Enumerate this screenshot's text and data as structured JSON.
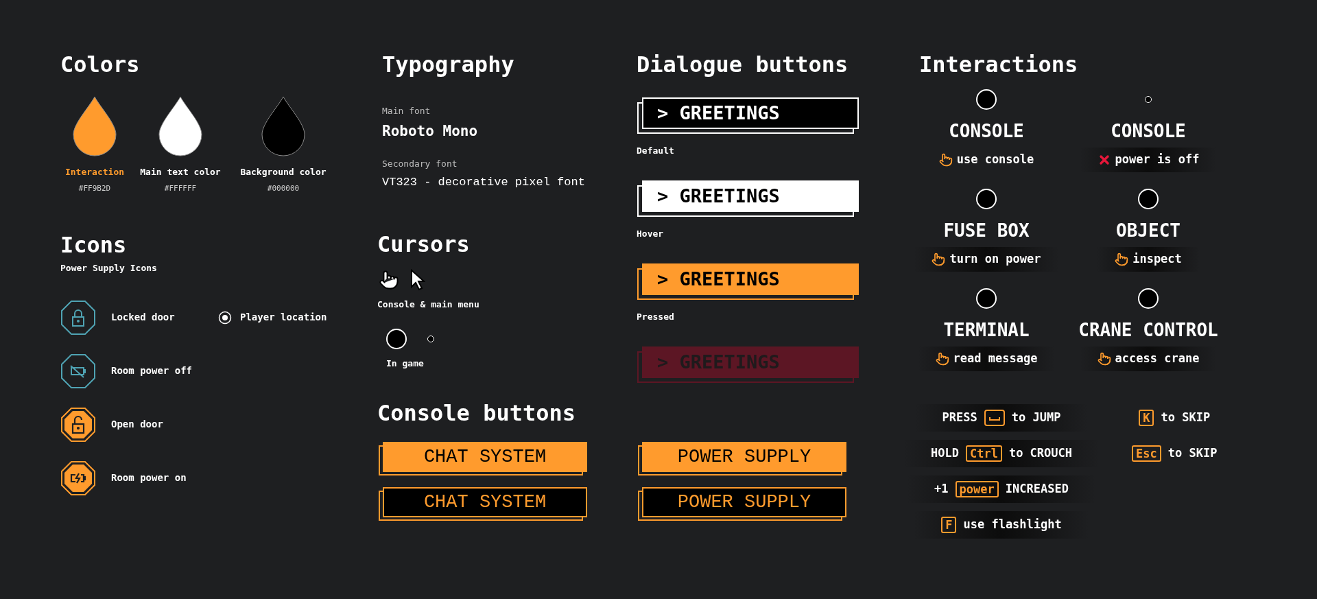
{
  "colors": {
    "title": "Colors",
    "swatches": [
      {
        "name": "Interaction",
        "hex": "#FF9B2D",
        "color": "#ff9b2d",
        "accent": true
      },
      {
        "name": "Main text color",
        "hex": "#FFFFFF",
        "color": "#ffffff",
        "accent": false
      },
      {
        "name": "Background color",
        "hex": "#000000",
        "color": "#000000",
        "accent": false
      }
    ]
  },
  "icons": {
    "title": "Icons",
    "subtitle": "Power Supply Icons",
    "items": [
      {
        "label": "Locked door",
        "kind": "lock",
        "active": false
      },
      {
        "label": "Room power off",
        "kind": "battery",
        "active": false
      },
      {
        "label": "Open door",
        "kind": "unlock",
        "active": true
      },
      {
        "label": "Room power on",
        "kind": "charging",
        "active": true
      }
    ],
    "marker": {
      "label": "Player location"
    }
  },
  "typography": {
    "title": "Typography",
    "fonts": [
      {
        "role": "Main font",
        "name": "Roboto Mono",
        "kind": "main"
      },
      {
        "role": "Secondary font",
        "name": "VT323 - decorative pixel font",
        "kind": "pixel"
      }
    ]
  },
  "cursors": {
    "title": "Cursors",
    "groups": [
      {
        "kind": "pointer",
        "caption": "Console & main menu"
      },
      {
        "kind": "dot",
        "caption": "In game"
      }
    ]
  },
  "dialogue_buttons": {
    "title": "Dialogue buttons",
    "buttons": [
      {
        "label": "> GREETINGS",
        "kind": "default",
        "caption": "Default"
      },
      {
        "label": "> GREETINGS",
        "kind": "hover",
        "caption": "Hover"
      },
      {
        "label": "> GREETINGS",
        "kind": "pressed",
        "caption": "Pressed"
      },
      {
        "label": "> GREETINGS",
        "kind": "disabled"
      }
    ]
  },
  "console_buttons": {
    "title": "Console buttons",
    "columns": [
      {
        "buttons": [
          {
            "label": "CHAT SYSTEM",
            "kind": "filled"
          },
          {
            "label": "CHAT SYSTEM",
            "kind": "outline"
          }
        ]
      },
      {
        "buttons": [
          {
            "label": "POWER SUPPLY",
            "kind": "filled"
          },
          {
            "label": "POWER SUPPLY",
            "kind": "outline"
          }
        ]
      }
    ]
  },
  "interactions": {
    "title": "Interactions",
    "items": [
      {
        "kind": "available",
        "title": "CONSOLE",
        "prompt": "use console",
        "backdrop": false
      },
      {
        "kind": "unavailable",
        "title": "CONSOLE",
        "prompt": "power is off",
        "backdrop": true
      },
      {
        "kind": "available",
        "title": "FUSE BOX",
        "prompt": "turn on power",
        "backdrop": true
      },
      {
        "kind": "available",
        "title": "OBJECT",
        "prompt": "inspect",
        "backdrop": true
      },
      {
        "kind": "available",
        "title": "TERMINAL",
        "prompt": "read message",
        "backdrop": true
      },
      {
        "kind": "available",
        "title": "CRANE CONTROL",
        "prompt": "access crane",
        "backdrop": true
      }
    ]
  },
  "key_prompts": {
    "rows": [
      {
        "backdrop": true,
        "parts": [
          {
            "kind": "text",
            "text": "PRESS"
          },
          {
            "kind": "space_key"
          },
          {
            "kind": "text",
            "text": "to JUMP"
          }
        ]
      },
      {
        "backdrop": true,
        "parts": [
          {
            "kind": "text",
            "text": "HOLD"
          },
          {
            "kind": "key",
            "text": "Ctrl"
          },
          {
            "kind": "text",
            "text": "to CROUCH"
          }
        ]
      },
      {
        "backdrop": true,
        "parts": [
          {
            "kind": "text",
            "text": "+1"
          },
          {
            "kind": "key",
            "text": "power"
          },
          {
            "kind": "text",
            "text": "INCREASED"
          }
        ]
      },
      {
        "backdrop": true,
        "parts": [
          {
            "kind": "key",
            "text": "F"
          },
          {
            "kind": "text",
            "text": "use flashlight"
          }
        ]
      }
    ],
    "shortcuts": [
      {
        "backdrop": false,
        "parts": [
          {
            "kind": "key",
            "text": "K"
          },
          {
            "kind": "text",
            "text": "to SKIP"
          }
        ]
      },
      {
        "backdrop": false,
        "parts": [
          {
            "kind": "key",
            "text": "Esc"
          },
          {
            "kind": "text",
            "text": "to SKIP"
          }
        ]
      }
    ]
  }
}
